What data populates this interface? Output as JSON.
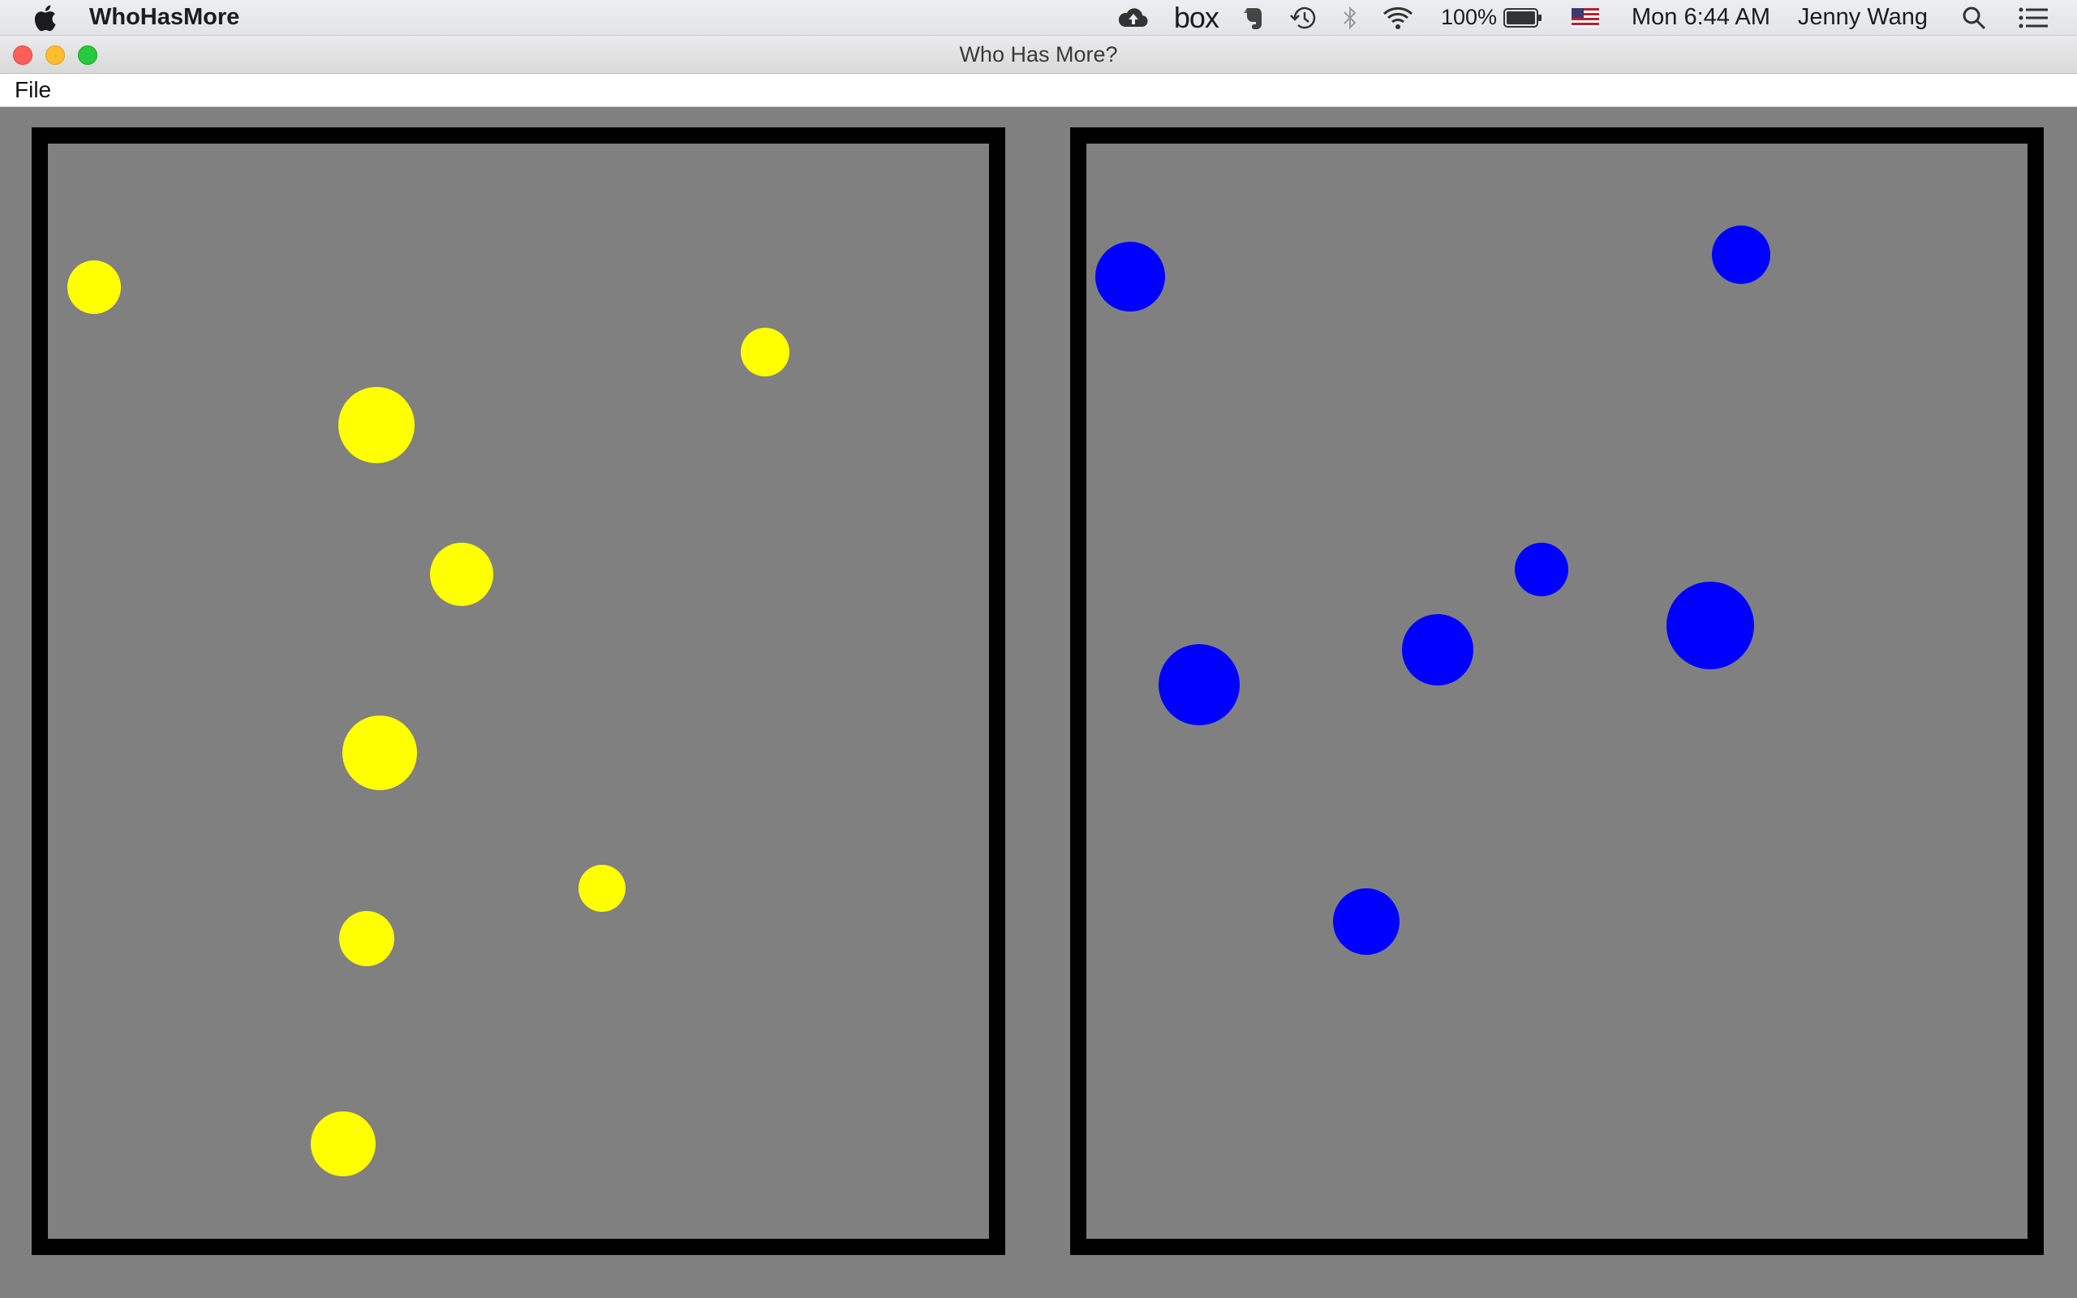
{
  "menubar": {
    "app_name": "WhoHasMore",
    "battery_percent": "100%",
    "clock": "Mon 6:44 AM",
    "user_name": "Jenny Wang",
    "status_icons": [
      "cloud-upload-icon",
      "box-logo",
      "evernote-icon",
      "time-machine-icon",
      "bluetooth-icon",
      "wifi-icon",
      "battery-icon",
      "us-flag-icon",
      "spotlight-search-icon",
      "notification-center-icon"
    ],
    "box_label": "box"
  },
  "window": {
    "title": "Who Has More?"
  },
  "app_menu": {
    "file_label": "File"
  },
  "game": {
    "left_panel": {
      "dot_color": "#ffff00",
      "dot_count": 8
    },
    "right_panel": {
      "dot_color": "#0000ff",
      "dot_count": 7
    },
    "background_color": "#808080",
    "border_color": "#000000"
  }
}
